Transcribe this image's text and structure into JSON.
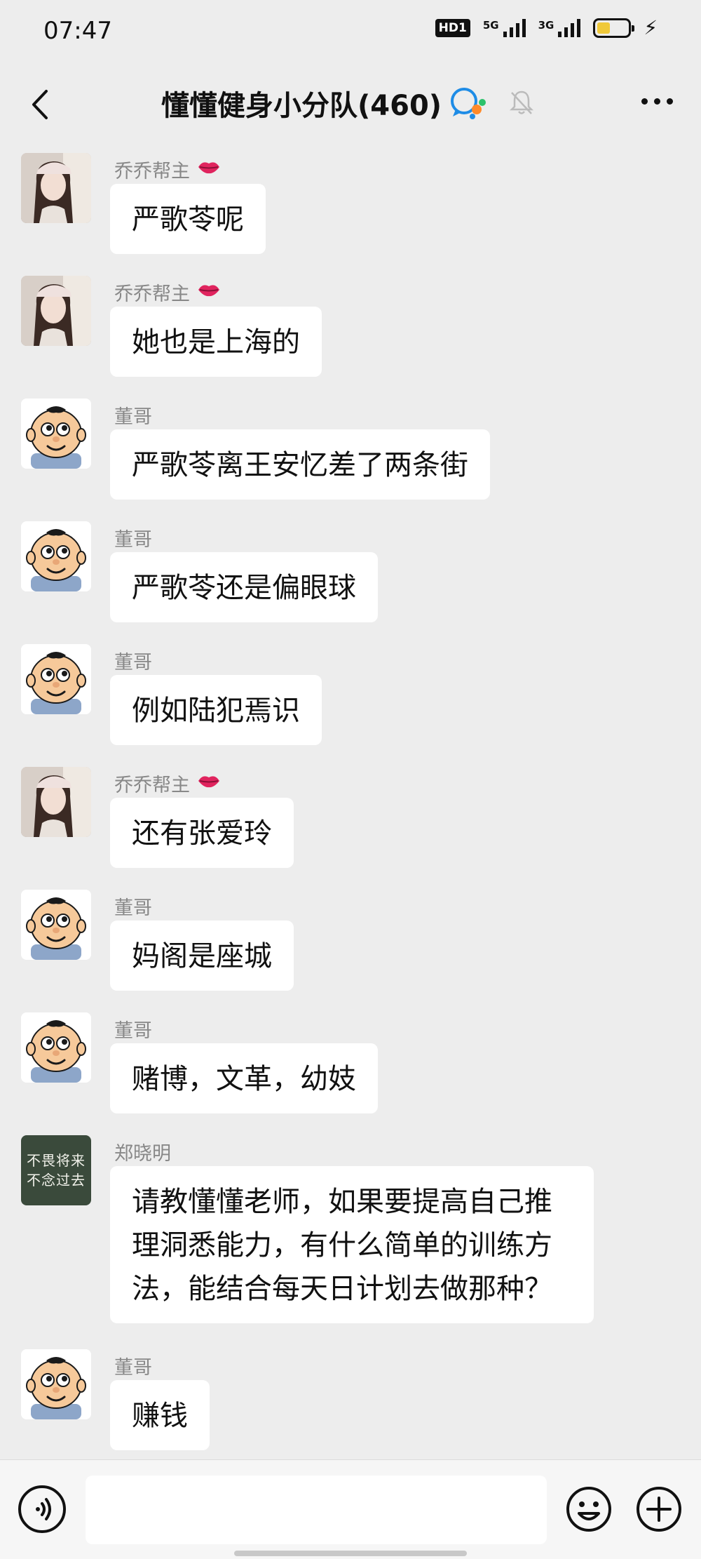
{
  "status_bar": {
    "time": "07:47",
    "hd_label": "HD1",
    "signal1_label": "5G",
    "signal2_label": "3G"
  },
  "header": {
    "title": "懂懂健身小分队(460)"
  },
  "messages": [
    {
      "sender": "乔乔帮主",
      "avatar": "girl-avatar",
      "badge": "lips-emoji",
      "text": "严歌苓呢"
    },
    {
      "sender": "乔乔帮主",
      "avatar": "girl-avatar",
      "badge": "lips-emoji",
      "text": "她也是上海的"
    },
    {
      "sender": "董哥",
      "avatar": "cartoon-baby-avatar",
      "text": "严歌苓离王安忆差了两条街"
    },
    {
      "sender": "董哥",
      "avatar": "cartoon-baby-avatar",
      "text": "严歌苓还是偏眼球"
    },
    {
      "sender": "董哥",
      "avatar": "cartoon-baby-avatar",
      "text": "例如陆犯焉识"
    },
    {
      "sender": "乔乔帮主",
      "avatar": "girl-avatar",
      "badge": "lips-emoji",
      "text": "还有张爱玲"
    },
    {
      "sender": "董哥",
      "avatar": "cartoon-baby-avatar",
      "text": "妈阁是座城"
    },
    {
      "sender": "董哥",
      "avatar": "cartoon-baby-avatar",
      "text": "赌博，文革，幼妓"
    },
    {
      "sender": "郑晓明",
      "avatar": "text-avatar",
      "avatar_text_line1": "不畏将来",
      "avatar_text_line2": "不念过去",
      "text": "请教懂懂老师，如果要提高自己推理洞悉能力，有什么简单的训练方法，能结合每天日计划去做那种？"
    },
    {
      "sender": "董哥",
      "avatar": "cartoon-baby-avatar",
      "text": "赚钱"
    }
  ],
  "input_bar": {
    "placeholder": ""
  },
  "colors": {
    "background": "#ededed",
    "bubble": "#ffffff",
    "sender_name": "#888888"
  }
}
